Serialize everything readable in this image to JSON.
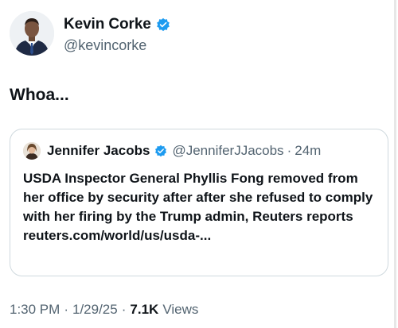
{
  "author": {
    "display_name": "Kevin Corke",
    "handle": "@kevincorke",
    "avatar_icon": "profile-photo",
    "verified": true
  },
  "tweet": {
    "text": "Whoa..."
  },
  "quoted_tweet": {
    "display_name": "Jennifer Jacobs",
    "handle": "@JenniferJJacobs",
    "separator": "·",
    "time": "24m",
    "verified": true,
    "text": "USDA Inspector General Phyllis Fong removed from her office by security after after she refused to comply with her firing by the Trump admin, Reuters reports\nreuters.com/world/us/usda-..."
  },
  "meta": {
    "time": "1:30 PM",
    "sep1": "·",
    "date": "1/29/25",
    "sep2": "·",
    "views_count": "7.1K",
    "views_label": "Views"
  },
  "colors": {
    "verified_blue": "#1d9bf0",
    "text_primary": "#0f1419",
    "text_secondary": "#536471",
    "border": "#cfd9de"
  }
}
